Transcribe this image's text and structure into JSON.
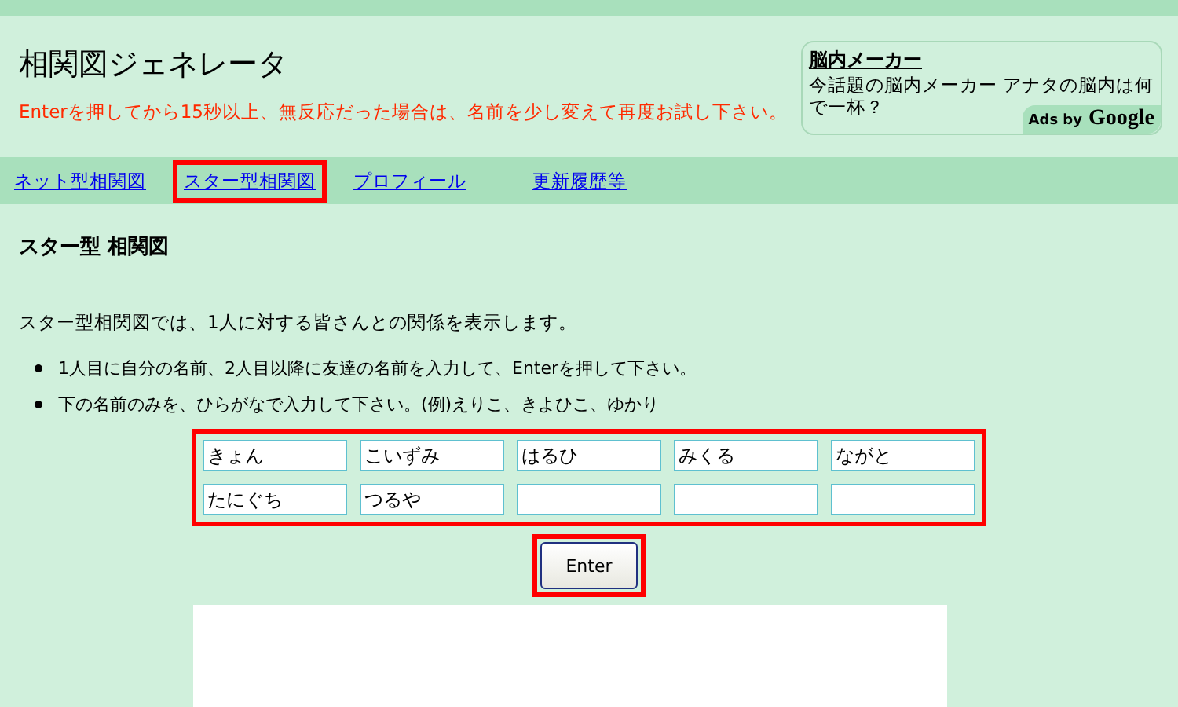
{
  "header": {
    "title": "相関図ジェネレータ",
    "notice": "Enterを押してから15秒以上、無反応だった場合は、名前を少し変えて再度お試し下さい。"
  },
  "ad": {
    "title": "脳内メーカー",
    "text": "今話題の脳内メーカー アナタの脳内は何で一杯？",
    "badge_small": "Ads by",
    "badge_brand": "Google"
  },
  "nav": [
    {
      "label": "ネット型相関図",
      "highlighted": false
    },
    {
      "label": "スター型相関図",
      "highlighted": true
    },
    {
      "label": "プロフィール",
      "highlighted": false
    },
    {
      "label": "更新履歴等",
      "highlighted": false
    }
  ],
  "heading": "スター型 相関図",
  "intro": "スター型相関図では、1人に対する皆さんとの関係を表示します。",
  "bullets": [
    "1人目に自分の名前、2人目以降に友達の名前を入力して、Enterを押して下さい。",
    "下の名前のみを、ひらがなで入力して下さい。(例)えりこ、きよひこ、ゆかり"
  ],
  "name_grid": {
    "highlighted": true,
    "fields": [
      {
        "kind": "filled",
        "value": "きょん"
      },
      {
        "kind": "filled",
        "value": "こいずみ"
      },
      {
        "kind": "filled",
        "value": "はるひ"
      },
      {
        "kind": "filled",
        "value": "みくる"
      },
      {
        "kind": "filled",
        "value": "ながと"
      },
      {
        "kind": "filled",
        "value": "たにぐち"
      },
      {
        "kind": "filled",
        "value": "つるや"
      },
      {
        "kind": "blank"
      },
      {
        "kind": "blank"
      },
      {
        "kind": "blank"
      }
    ]
  },
  "enter_button": {
    "label": "Enter",
    "highlighted": true
  }
}
